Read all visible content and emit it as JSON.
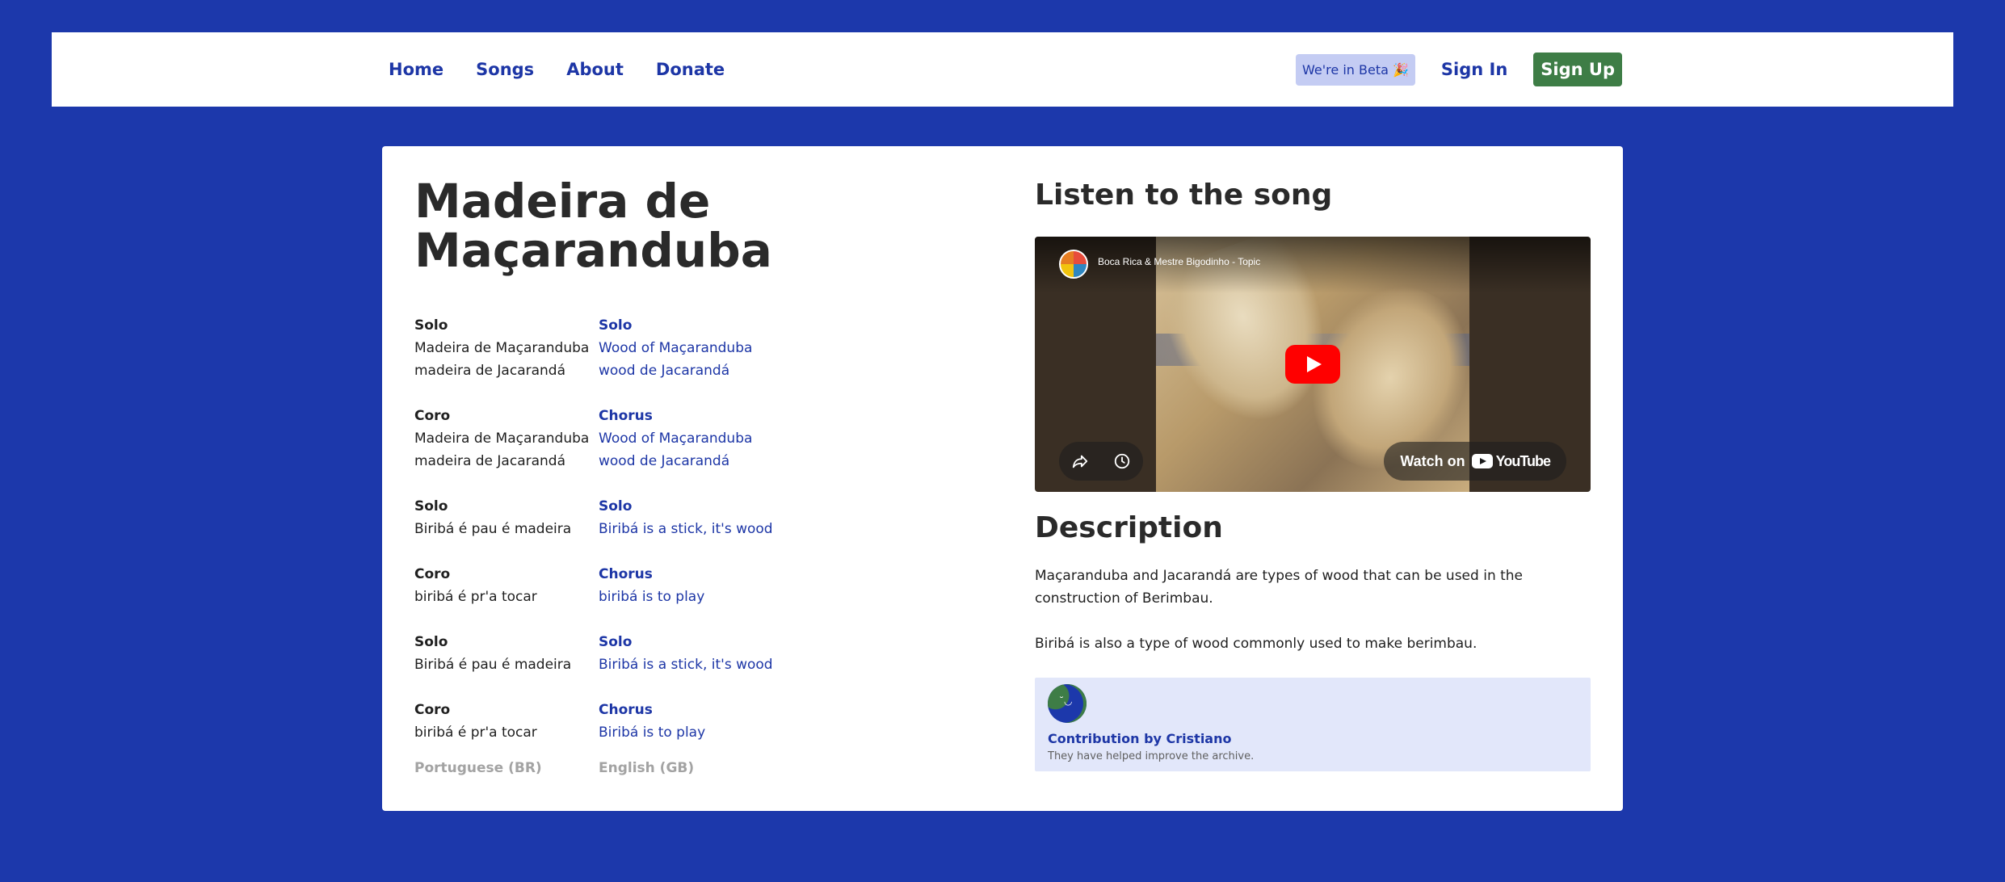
{
  "nav": {
    "links": [
      "Home",
      "Songs",
      "About",
      "Donate"
    ],
    "beta_badge": "We're in Beta 🎉",
    "sign_in": "Sign In",
    "sign_up": "Sign Up"
  },
  "song": {
    "title": "Madeira de Maçaranduba",
    "stanzas": [
      {
        "pt_label": "Solo",
        "pt_lines": [
          "Madeira de Maçaranduba",
          "madeira de Jacarandá"
        ],
        "en_label": "Solo",
        "en_lines": [
          "Wood of Maçaranduba",
          "wood de Jacarandá"
        ]
      },
      {
        "pt_label": "Coro",
        "pt_lines": [
          "Madeira de Maçaranduba",
          "madeira de Jacarandá"
        ],
        "en_label": "Chorus",
        "en_lines": [
          "Wood of Maçaranduba",
          "wood de Jacarandá"
        ]
      },
      {
        "pt_label": "Solo",
        "pt_lines": [
          "Biribá é pau é madeira"
        ],
        "en_label": "Solo",
        "en_lines": [
          "Biribá is a stick, it's wood"
        ]
      },
      {
        "pt_label": "Coro",
        "pt_lines": [
          "biribá é pr'a tocar"
        ],
        "en_label": "Chorus",
        "en_lines": [
          "biribá is to play"
        ]
      },
      {
        "pt_label": "Solo",
        "pt_lines": [
          "Biribá é pau é madeira"
        ],
        "en_label": "Solo",
        "en_lines": [
          "Biribá is a stick, it's wood"
        ]
      },
      {
        "pt_label": "Coro",
        "pt_lines": [
          "biribá é pr'a tocar"
        ],
        "en_label": "Chorus",
        "en_lines": [
          "Biribá is to play"
        ]
      }
    ],
    "lang_pt": "Portuguese (BR)",
    "lang_en": "English (GB)"
  },
  "listen": {
    "heading": "Listen to the song",
    "video": {
      "channel": "Boca Rica & Mestre Bigodinho - Topic",
      "watch_on": "Watch on",
      "brand": "YouTube",
      "icons": [
        "share-icon",
        "clock-icon",
        "play-icon",
        "youtube-logo-icon"
      ]
    }
  },
  "description": {
    "heading": "Description",
    "paragraphs": [
      "Maçaranduba and Jacarandá are types of wood that can be used in the construction of Berimbau.",
      "Biribá is also a type of wood commonly used to make berimbau."
    ]
  },
  "contribution": {
    "title": "Contribution by Cristiano",
    "subtitle": "They have helped improve the archive."
  },
  "colors": {
    "background": "#1c38ab",
    "link": "#1d36a6",
    "signup": "#3e7d46",
    "beta_badge": "#c4ccf3",
    "contribution_bg": "#e2e7fa"
  }
}
